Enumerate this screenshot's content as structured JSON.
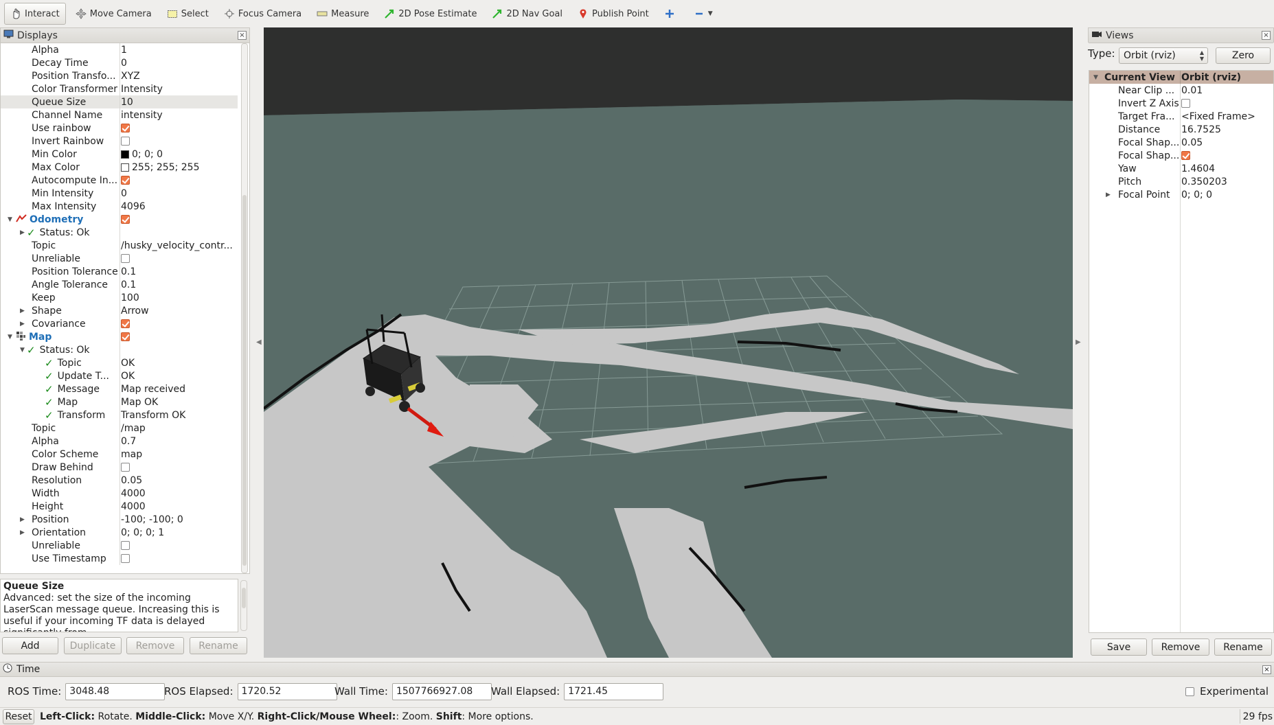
{
  "toolbar": {
    "interact": "Interact",
    "move_camera": "Move Camera",
    "select": "Select",
    "focus_camera": "Focus Camera",
    "measure": "Measure",
    "pose_estimate": "2D Pose Estimate",
    "nav_goal": "2D Nav Goal",
    "publish_point": "Publish Point"
  },
  "displays": {
    "title": "Displays",
    "rows": [
      {
        "key": "Alpha",
        "val": "1"
      },
      {
        "key": "Decay Time",
        "val": "0"
      },
      {
        "key": "Position Transfo...",
        "val": "XYZ"
      },
      {
        "key": "Color Transformer",
        "val": "Intensity"
      },
      {
        "key": "Queue Size",
        "val": "10"
      },
      {
        "key": "Channel Name",
        "val": "intensity"
      },
      {
        "key": "Use rainbow",
        "val": ""
      },
      {
        "key": "Invert Rainbow",
        "val": ""
      },
      {
        "key": "Min Color",
        "val": "0; 0; 0"
      },
      {
        "key": "Max Color",
        "val": "255; 255; 255"
      },
      {
        "key": "Autocompute In...",
        "val": ""
      },
      {
        "key": "Min Intensity",
        "val": "0"
      },
      {
        "key": "Max Intensity",
        "val": "4096"
      },
      {
        "key": "Odometry",
        "val": ""
      },
      {
        "key": "Status: Ok",
        "val": ""
      },
      {
        "key": "Topic",
        "val": "/husky_velocity_contr..."
      },
      {
        "key": "Unreliable",
        "val": ""
      },
      {
        "key": "Position Tolerance",
        "val": "0.1"
      },
      {
        "key": "Angle Tolerance",
        "val": "0.1"
      },
      {
        "key": "Keep",
        "val": "100"
      },
      {
        "key": "Shape",
        "val": "Arrow"
      },
      {
        "key": "Covariance",
        "val": ""
      },
      {
        "key": "Map",
        "val": ""
      },
      {
        "key": "Status: Ok",
        "val": ""
      },
      {
        "key": "Topic",
        "val": "OK"
      },
      {
        "key": "Update T...",
        "val": "OK"
      },
      {
        "key": "Message",
        "val": "Map received"
      },
      {
        "key": "Map",
        "val": "Map OK"
      },
      {
        "key": "Transform",
        "val": "Transform OK"
      },
      {
        "key": "Topic",
        "val": "/map"
      },
      {
        "key": "Alpha",
        "val": "0.7"
      },
      {
        "key": "Color Scheme",
        "val": "map"
      },
      {
        "key": "Draw Behind",
        "val": ""
      },
      {
        "key": "Resolution",
        "val": "0.05"
      },
      {
        "key": "Width",
        "val": "4000"
      },
      {
        "key": "Height",
        "val": "4000"
      },
      {
        "key": "Position",
        "val": "-100; -100; 0"
      },
      {
        "key": "Orientation",
        "val": "0; 0; 0; 1"
      },
      {
        "key": "Unreliable",
        "val": ""
      },
      {
        "key": "Use Timestamp",
        "val": ""
      }
    ],
    "description_title": "Queue Size",
    "description_text": "Advanced: set the size of the incoming LaserScan message queue. Increasing this is useful if your incoming TF data is delayed significantly from",
    "buttons": {
      "add": "Add",
      "duplicate": "Duplicate",
      "remove": "Remove",
      "rename": "Rename"
    }
  },
  "views": {
    "title": "Views",
    "type_label": "Type:",
    "type_value": "Orbit (rviz)",
    "zero": "Zero",
    "rows": [
      {
        "key": "Current View",
        "val": "Orbit (rviz)"
      },
      {
        "key": "Near Clip ...",
        "val": "0.01"
      },
      {
        "key": "Invert Z Axis",
        "val": ""
      },
      {
        "key": "Target Fra...",
        "val": "<Fixed Frame>"
      },
      {
        "key": "Distance",
        "val": "16.7525"
      },
      {
        "key": "Focal Shap...",
        "val": "0.05"
      },
      {
        "key": "Focal Shap...",
        "val": ""
      },
      {
        "key": "Yaw",
        "val": "1.4604"
      },
      {
        "key": "Pitch",
        "val": "0.350203"
      },
      {
        "key": "Focal Point",
        "val": "0; 0; 0"
      }
    ],
    "buttons": {
      "save": "Save",
      "remove": "Remove",
      "rename": "Rename"
    }
  },
  "time": {
    "title": "Time",
    "ros_time_label": "ROS Time:",
    "ros_time": "3048.48",
    "ros_elapsed_label": "ROS Elapsed:",
    "ros_elapsed": "1720.52",
    "wall_time_label": "Wall Time:",
    "wall_time": "1507766927.08",
    "wall_elapsed_label": "Wall Elapsed:",
    "wall_elapsed": "1721.45",
    "experimental": "Experimental"
  },
  "status": {
    "reset": "Reset",
    "help_left": "Left-Click:",
    "help_left_text": " Rotate. ",
    "help_middle": "Middle-Click:",
    "help_middle_text": " Move X/Y. ",
    "help_right": "Right-Click/Mouse Wheel:",
    "help_right_text": ": Zoom. ",
    "help_shift": "Shift",
    "help_shift_text": ": More options.",
    "fps": "29 fps"
  }
}
